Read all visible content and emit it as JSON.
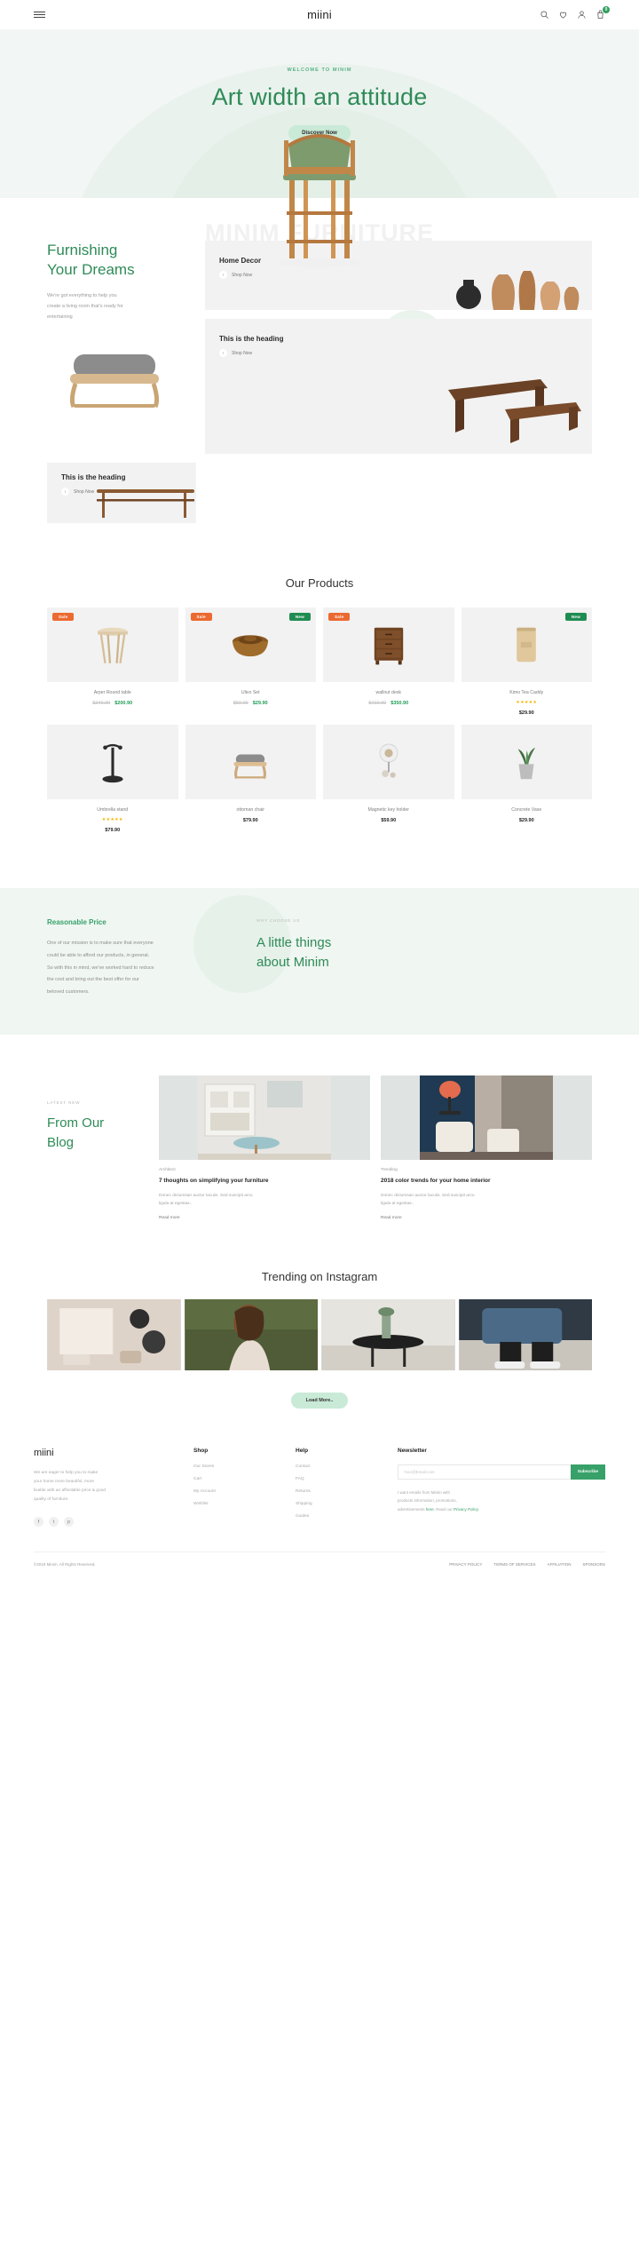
{
  "header": {
    "logo": "miini",
    "menu_icon": "hamburger-icon",
    "icons": [
      {
        "name": "search-icon"
      },
      {
        "name": "wishlist-heart-icon"
      },
      {
        "name": "user-account-icon"
      },
      {
        "name": "cart-icon"
      }
    ],
    "cart_count": "0"
  },
  "hero": {
    "eyebrow": "WELCOME TO MINIM",
    "title": "Art width an attitude",
    "button": "Discover Now",
    "watermark": "MINIM FURNITURE"
  },
  "furnishing": {
    "title_line1": "Furnishing",
    "title_line2": "Your Dreams",
    "desc_line1": "We're got everything to help you",
    "desc_line2": "create a living room that's ready for",
    "desc_line3": "entertaining",
    "tiles": [
      {
        "heading": "Home Decor",
        "cta": "Shop Now"
      },
      {
        "heading": "This is the heading",
        "cta": "Shop Now"
      },
      {
        "heading": "This is the heading",
        "cta": "Shop Now"
      }
    ]
  },
  "products": {
    "title": "Our Products",
    "items": [
      {
        "name": "Arper Round table",
        "old_price": "$240.00",
        "price": "$200.90",
        "badges": [
          "Sale"
        ],
        "rating": 0
      },
      {
        "name": "Ulivo Set",
        "old_price": "$59.00",
        "price": "$29.90",
        "badges": [
          "Sale",
          "New"
        ],
        "rating": 0
      },
      {
        "name": "wallnut desk",
        "old_price": "$410.00",
        "price": "$350.90",
        "badges": [
          "Sale"
        ],
        "rating": 0
      },
      {
        "name": "Kimo Tea Caddy",
        "old_price": "",
        "price": "$29.90",
        "badges": [
          "New"
        ],
        "rating": 5
      },
      {
        "name": "Umbrella stand",
        "old_price": "",
        "price": "$79.90",
        "badges": [],
        "rating": 5
      },
      {
        "name": "ottoman chair",
        "old_price": "",
        "price": "$79.90",
        "badges": [],
        "rating": 0
      },
      {
        "name": "Magnetic key holder",
        "old_price": "",
        "price": "$59.90",
        "badges": [],
        "rating": 0
      },
      {
        "name": "Concrete Vase",
        "old_price": "",
        "price": "$29.90",
        "badges": [],
        "rating": 0
      }
    ],
    "badge_sale": "Sale",
    "badge_new": "New"
  },
  "reasonable": {
    "heading": "Reasonable Price",
    "body_l1": "One of our mission is to make sure that everyone",
    "body_l2": "could be able to afford our products, in general.",
    "body_l3": "So with this in mind, we've worked hard to reduce",
    "body_l4": "the cost and bring out the best offer for our",
    "body_l5": "beloved customers.",
    "right_eyebrow": "WHY CHOOSE US",
    "right_title_l1": "A little things",
    "right_title_l2": "about Minim"
  },
  "blog": {
    "eyebrow": "LATEST NEW",
    "title_l1": "From Our",
    "title_l2": "Blog",
    "posts": [
      {
        "category": "Architect",
        "title": "7 thoughts on simplifying your furniture",
        "excerpt_l1": "Donec dictumsan auctor lacuiis. Sed suscipit arcu",
        "excerpt_l2": "ligula at egestas..",
        "more": "Read more"
      },
      {
        "category": "Trending",
        "title": "2018 color trends for your home interior",
        "excerpt_l1": "Donec dictumsan auctor lacuiis. Sed suscipit arcu",
        "excerpt_l2": "ligula at egestas..",
        "more": "Read more"
      }
    ]
  },
  "instagram": {
    "title": "Trending on Instagram",
    "load_more": "Load More.."
  },
  "footer": {
    "logo": "miini",
    "about_l1": "We are eager to help you to make",
    "about_l2": "your home more beautiful, more",
    "about_l3": "livable with an affordable price & good",
    "about_l4": "quality of furniture.",
    "socials": [
      {
        "name": "facebook-icon",
        "glyph": "f"
      },
      {
        "name": "twitter-icon",
        "glyph": "t"
      },
      {
        "name": "pinterest-icon",
        "glyph": "p"
      }
    ],
    "shop": {
      "heading": "Shop",
      "links": [
        "Our Stores",
        "Cart",
        "My Account",
        "Wishlist"
      ]
    },
    "help": {
      "heading": "Help",
      "links": [
        "Contact",
        "FAQ",
        "Returns",
        "Shipping",
        "Guides"
      ]
    },
    "newsletter": {
      "heading": "Newsletter",
      "placeholder": "Your@Email.com",
      "button": "Subscribe",
      "note_l1": "I want emails from Minim with",
      "note_l2": "products information, promotions,",
      "note_l3": "advertisements ",
      "note_link1": "here",
      "note_l4": ". Read our ",
      "note_link2": "Privacy Policy",
      "note_l5": "."
    },
    "copyright": "©2019 Minim. All Rights Reserved.",
    "legal": [
      "PRIVACY POLICY",
      "TERMS OF SERVICES",
      "AFFILIATION",
      "SPONSORS"
    ]
  },
  "colors": {
    "green": "#2e8b57",
    "accent_green": "#38a169",
    "sale_orange": "#ec6a31",
    "hero_bg": "#f2f6f4",
    "tile_bg": "#f2f2f2",
    "star": "#f6b500"
  }
}
